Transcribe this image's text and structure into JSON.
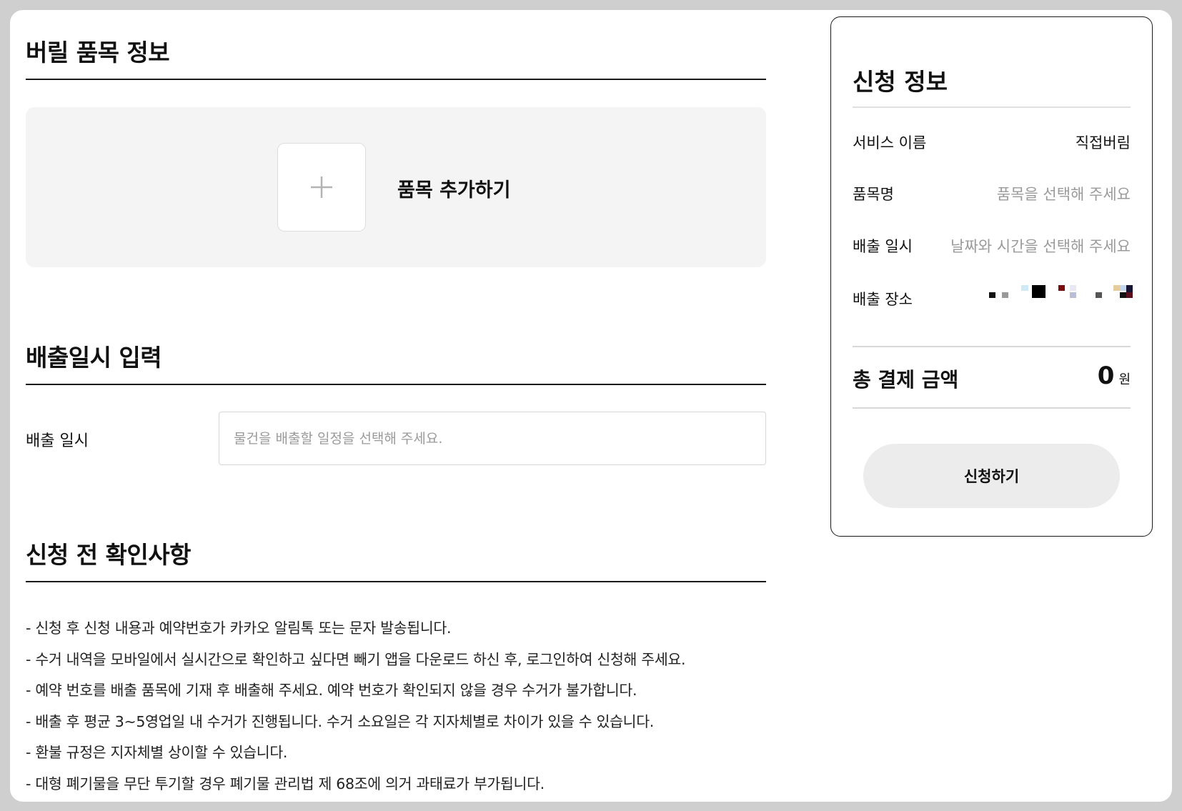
{
  "sections": {
    "items_title": "버릴 품목 정보",
    "add_item_label": "품목 추가하기",
    "datetime_title": "배출일시 입력",
    "datetime_label": "배출 일시",
    "datetime_placeholder": "물건을 배출할 일정을 선택해 주세요.",
    "notice_title": "신청 전 확인사항",
    "notices": [
      "- 신청 후 신청 내용과 예약번호가 카카오 알림톡 또는 문자 발송됩니다.",
      "- 수거 내역을 모바일에서 실시간으로 확인하고 싶다면 빼기 앱을 다운로드 하신 후, 로그인하여 신청해 주세요.",
      "- 예약 번호를 배출 품목에 기재 후 배출해 주세요. 예약 번호가 확인되지 않을 경우 수거가 불가합니다.",
      "- 배출 후 평균 3~5영업일 내 수거가 진행됩니다. 수거 소요일은 각 지자체별로 차이가 있을 수 있습니다.",
      "- 환불 규정은 지자체별 상이할 수 있습니다.",
      "- 대형 폐기물을 무단 투기할 경우 폐기물 관리법 제 68조에 의거 과태료가 부가됩니다."
    ]
  },
  "summary": {
    "title": "신청 정보",
    "rows": [
      {
        "key": "서비스 이름",
        "value": "직접버림"
      },
      {
        "key": "품목명",
        "value": "품목을 선택해 주세요"
      },
      {
        "key": "배출 일시",
        "value": "날짜와 시간을 선택해 주세요"
      },
      {
        "key": "배출 장소",
        "value": ""
      }
    ],
    "total_label": "총 결제 금액",
    "total_value": "0",
    "total_unit": "원",
    "apply_label": "신청하기"
  },
  "icons": {
    "add": "plus-icon"
  },
  "colors": {
    "panel_bg": "#f4f4f4",
    "button_bg": "#ececec",
    "placeholder": "#9a9a9a"
  }
}
